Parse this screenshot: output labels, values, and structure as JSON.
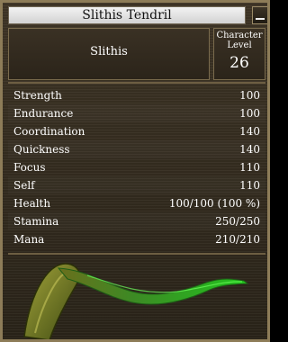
{
  "window": {
    "title": "Slithis Tendril"
  },
  "character": {
    "name": "Slithis",
    "level_label": "Character Level",
    "level": "26"
  },
  "stats": [
    {
      "label": "Strength",
      "value": "100"
    },
    {
      "label": "Endurance",
      "value": "100"
    },
    {
      "label": "Coordination",
      "value": "140"
    },
    {
      "label": "Quickness",
      "value": "140"
    },
    {
      "label": "Focus",
      "value": "110"
    },
    {
      "label": "Self",
      "value": "110"
    },
    {
      "label": "Health",
      "value": "100/100 (100 %)"
    },
    {
      "label": "Stamina",
      "value": "250/250"
    },
    {
      "label": "Mana",
      "value": "210/210"
    }
  ],
  "icons": {
    "close": "minimize-icon",
    "portrait": "tendril-portrait"
  },
  "colors": {
    "frame": "#8d7c58",
    "panel": "#3f3526",
    "title_bar": "#e6e6e6",
    "tendril": "#2fb52f"
  }
}
